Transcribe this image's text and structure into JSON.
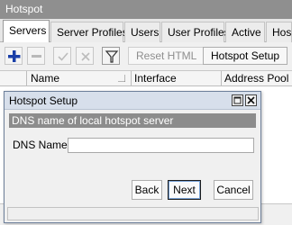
{
  "window": {
    "title": "Hotspot"
  },
  "tabs": [
    {
      "label": "Servers",
      "active": true
    },
    {
      "label": "Server Profiles"
    },
    {
      "label": "Users"
    },
    {
      "label": "User Profiles"
    },
    {
      "label": "Active"
    },
    {
      "label": "Host"
    }
  ],
  "toolbar": {
    "icons": [
      "add-icon",
      "remove-icon",
      "enable-check-icon",
      "disable-x-icon",
      "filter-icon"
    ],
    "reset_html_label": "Reset HTML",
    "hotspot_setup_label": "Hotspot Setup"
  },
  "table": {
    "columns": [
      "Name",
      "Interface",
      "Address Pool"
    ]
  },
  "dialog": {
    "title": "Hotspot Setup",
    "description": "DNS name of local hotspot server",
    "dns_label": "DNS Name:",
    "dns_value": "",
    "buttons": {
      "back": "Back",
      "next": "Next",
      "cancel": "Cancel"
    }
  },
  "colors": {
    "titlebar": "#8f8f8f",
    "dialog_title": "#d7dfeb",
    "description_bar": "#8c8c8c",
    "add_icon": "#1a3fa8"
  }
}
